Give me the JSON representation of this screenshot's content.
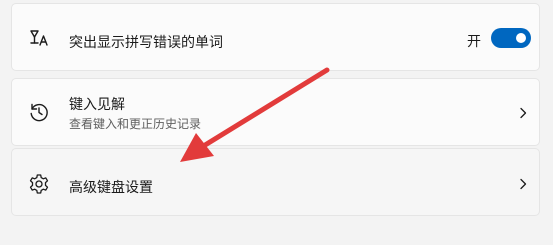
{
  "settings": {
    "highlight_misspelled": {
      "title": "突出显示拼写错误的单词",
      "toggle_label": "开",
      "toggle_on": true,
      "icon": "spellcheck-icon"
    },
    "typing_insights": {
      "title": "键入见解",
      "subtitle": "查看键入和更正历史记录",
      "icon": "history-icon"
    },
    "advanced_keyboard": {
      "title": "高级键盘设置",
      "icon": "gear-icon"
    }
  },
  "colors": {
    "accent": "#0067c0",
    "annotation_arrow": "#e23b3b"
  }
}
